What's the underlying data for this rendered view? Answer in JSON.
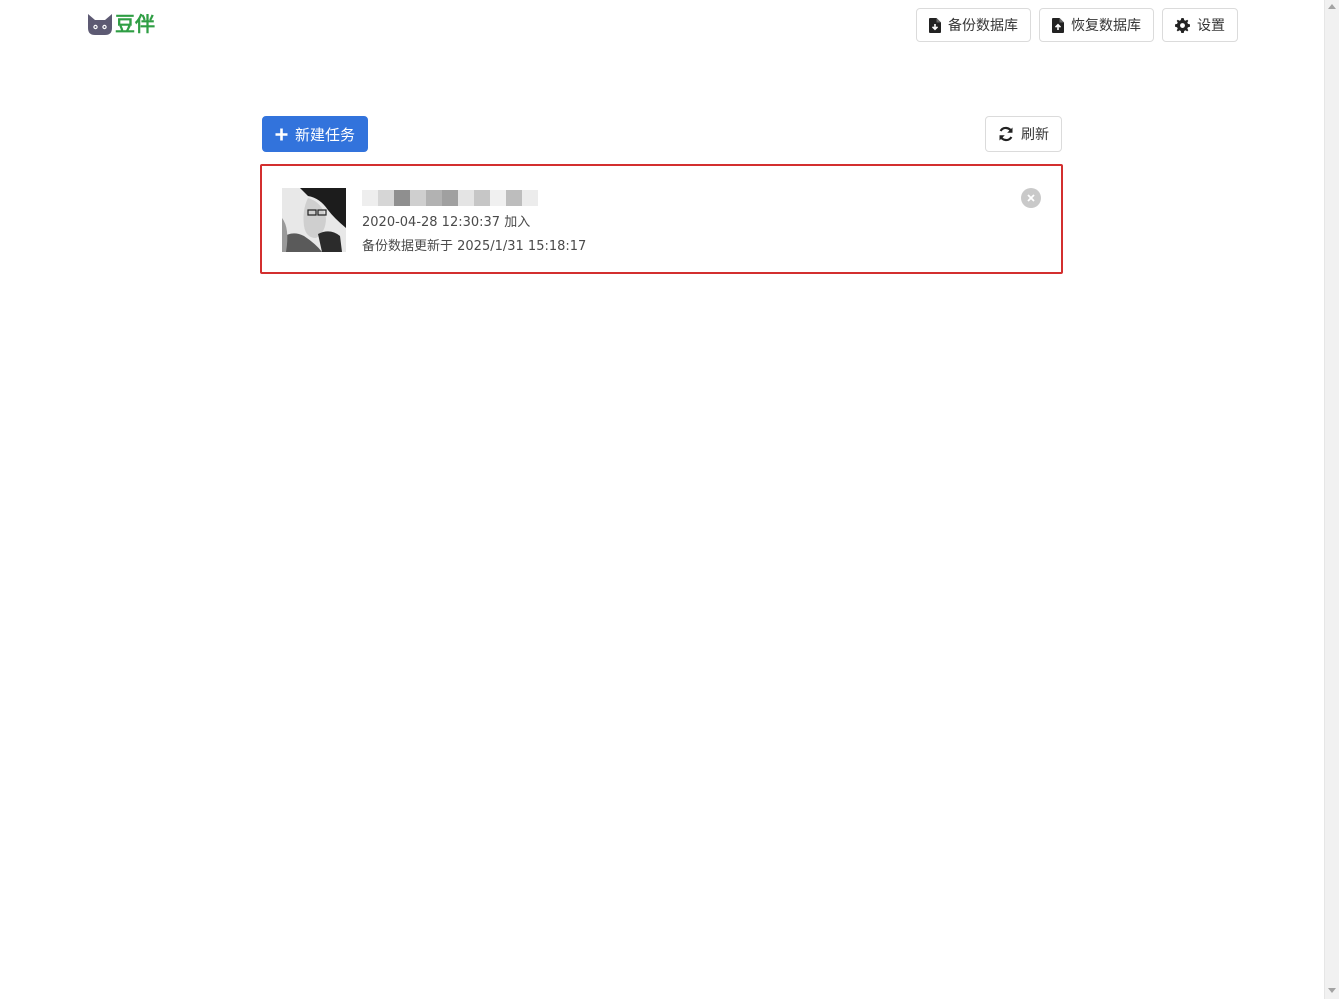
{
  "app": {
    "logo_text": "豆伴",
    "logo_icon": "cat-face-icon"
  },
  "header": {
    "backup_label": "备份数据库",
    "restore_label": "恢复数据库",
    "settings_label": "设置"
  },
  "toolbar": {
    "new_task_label": "新建任务",
    "refresh_label": "刷新"
  },
  "tasks": [
    {
      "name": "",
      "added": "2020-04-28 12:30:37 加入",
      "updated": "备份数据更新于 2025/1/31 15:18:17"
    }
  ],
  "colors": {
    "brand_green": "#2f9e44",
    "primary_blue": "#3273dc",
    "highlight_red": "#d32f2f"
  }
}
